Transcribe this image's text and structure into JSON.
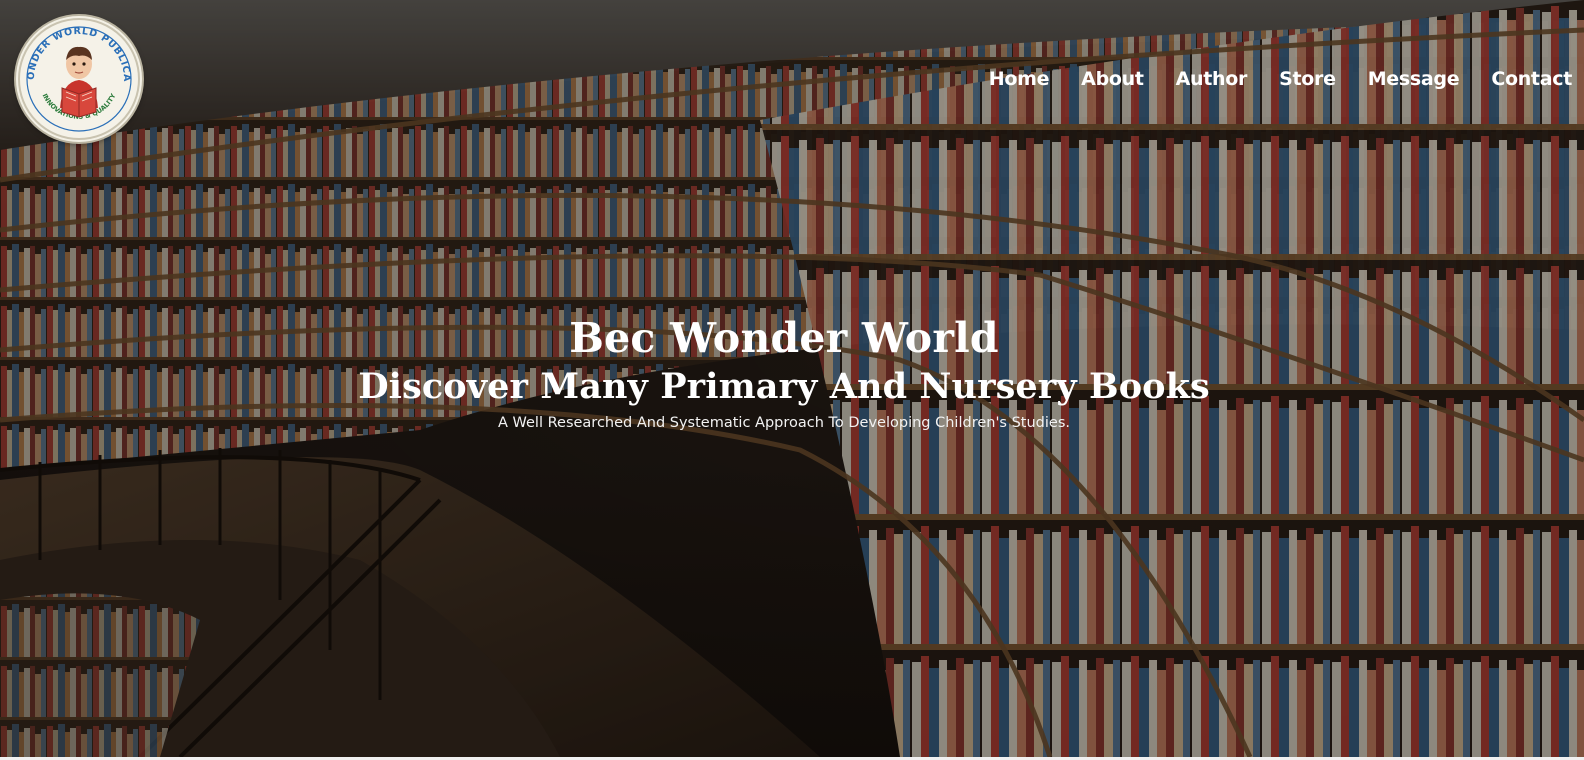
{
  "brand": {
    "logo_icon": "boy-reading-book-logo",
    "logo_text_top": "BEC WONDER WORLD PUBLICATIONS",
    "logo_text_bottom": "INNOVATIONS & QUALITY"
  },
  "nav": {
    "items": [
      {
        "label": "Home"
      },
      {
        "label": "About"
      },
      {
        "label": "Author"
      },
      {
        "label": "Store"
      },
      {
        "label": "Message"
      },
      {
        "label": "Contact"
      }
    ]
  },
  "hero": {
    "background": "library-bookshelves-photo",
    "title": "Bec Wonder World",
    "subtitle": "Discover Many Primary And Nursery Books",
    "tagline": "A Well Researched And Systematic Approach To Developing Children's Studies."
  },
  "colors": {
    "text": "#ffffff",
    "logo_blue": "#2a6fb8",
    "logo_red": "#c8342c"
  }
}
